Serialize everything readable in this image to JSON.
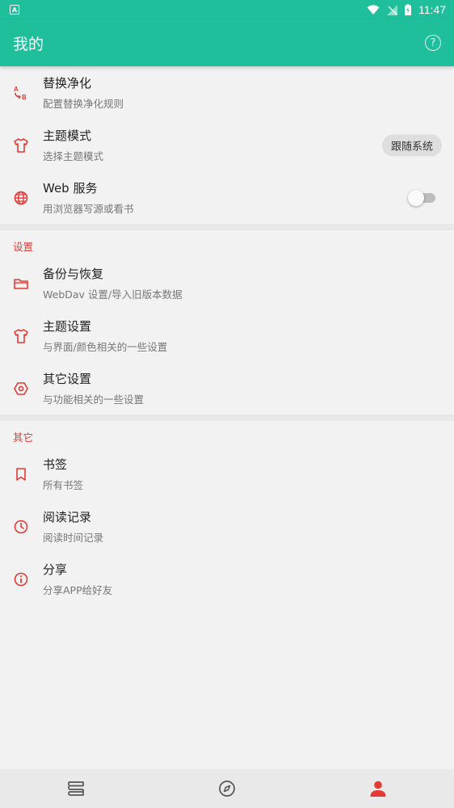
{
  "status_bar": {
    "time": "11:47",
    "notification_icon_text": "A"
  },
  "app_bar": {
    "title": "我的"
  },
  "colors": {
    "primary": "#1fbf9b",
    "accent": "#e53935"
  },
  "items_top": [
    {
      "title": "替换净化",
      "subtitle": "配置替换净化规则",
      "icon": "replace-ab-icon"
    },
    {
      "title": "主题模式",
      "subtitle": "选择主题模式",
      "icon": "tshirt-icon",
      "chip": "跟随系统"
    },
    {
      "title": "Web 服务",
      "subtitle": "用浏览器写源或看书",
      "icon": "globe-icon",
      "switch_on": false
    }
  ],
  "settings_section": {
    "header": "设置",
    "items": [
      {
        "title": "备份与恢复",
        "subtitle": "WebDav 设置/导入旧版本数据",
        "icon": "folder-icon"
      },
      {
        "title": "主题设置",
        "subtitle": "与界面/颜色相关的一些设置",
        "icon": "tshirt-icon"
      },
      {
        "title": "其它设置",
        "subtitle": "与功能相关的一些设置",
        "icon": "settings-hex-icon"
      }
    ]
  },
  "other_section": {
    "header": "其它",
    "items": [
      {
        "title": "书签",
        "subtitle": "所有书签",
        "icon": "bookmark-icon"
      },
      {
        "title": "阅读记录",
        "subtitle": "阅读时间记录",
        "icon": "clock-icon"
      },
      {
        "title": "分享",
        "subtitle": "分享APP给好友",
        "icon": "info-icon"
      }
    ]
  },
  "bottom_nav": [
    {
      "name": "bookshelf",
      "icon": "bookshelf-icon",
      "active": false
    },
    {
      "name": "discover",
      "icon": "compass-icon",
      "active": false
    },
    {
      "name": "my",
      "icon": "person-icon",
      "active": true
    }
  ]
}
